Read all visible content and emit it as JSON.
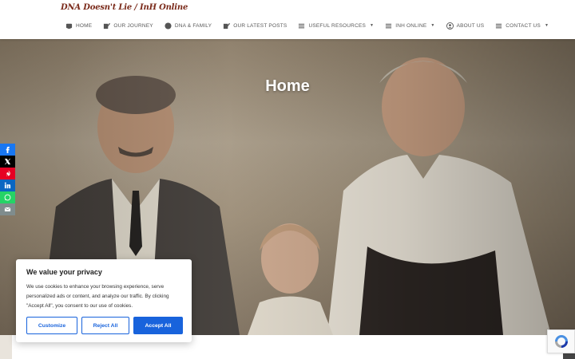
{
  "site": {
    "logo": "DNA Doesn't Lie / InH Online"
  },
  "nav": {
    "items": [
      {
        "label": "HOME",
        "icon": "home-icon",
        "dropdown": false
      },
      {
        "label": "OUR JOURNEY",
        "icon": "edit-icon",
        "dropdown": false
      },
      {
        "label": "DNA & FAMILY",
        "icon": "globe-icon",
        "dropdown": false
      },
      {
        "label": "OUR LATEST POSTS",
        "icon": "edit-icon",
        "dropdown": false
      },
      {
        "label": "USEFUL RESOURCES",
        "icon": "list-icon",
        "dropdown": true
      },
      {
        "label": "INH ONLINE",
        "icon": "list-icon",
        "dropdown": true
      },
      {
        "label": "ABOUT US",
        "icon": "user-circle-icon",
        "dropdown": false
      },
      {
        "label": "CONTACT US",
        "icon": "list-icon",
        "dropdown": true
      }
    ]
  },
  "hero": {
    "title": "Home"
  },
  "share": [
    {
      "name": "facebook-icon",
      "color": "#1877f2"
    },
    {
      "name": "x-icon",
      "color": "#000000"
    },
    {
      "name": "pinterest-icon",
      "color": "#e60023"
    },
    {
      "name": "linkedin-icon",
      "color": "#0a66c2"
    },
    {
      "name": "whatsapp-icon",
      "color": "#25d366"
    },
    {
      "name": "email-icon",
      "color": "#7f8c8d"
    }
  ],
  "cookie": {
    "title": "We value your privacy",
    "text": "We use cookies to enhance your browsing experience, serve personalized ads or content, and analyze our traffic. By clicking \"Accept All\", you consent to our use of cookies.",
    "customize": "Customize",
    "reject": "Reject All",
    "accept": "Accept All",
    "accent": "#1863dc"
  }
}
